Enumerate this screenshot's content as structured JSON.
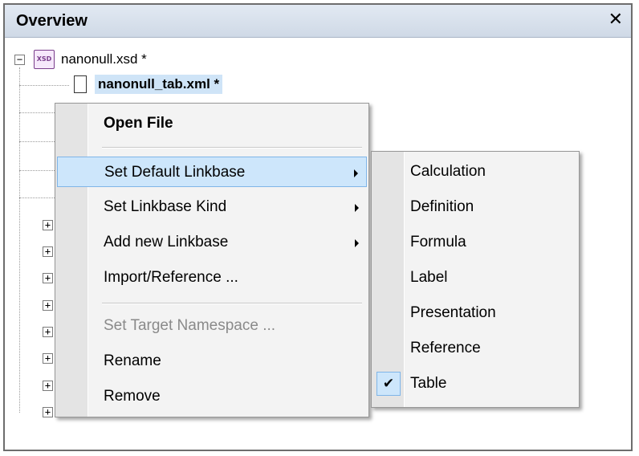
{
  "panel": {
    "title": "Overview",
    "close_glyph": "✕"
  },
  "tree": {
    "root": {
      "label": "nanonull.xsd *",
      "icon_text": "XSD",
      "icon": "xsd-file-icon",
      "expander": "−"
    },
    "selected_child": {
      "label": "nanonull_tab.xml *",
      "icon": "xml-file-icon"
    },
    "collapsed_expander": "+"
  },
  "context_menu": {
    "items": [
      {
        "label": "Open File"
      },
      {
        "label": "Set Default Linkbase"
      },
      {
        "label": "Set Linkbase Kind"
      },
      {
        "label": "Add new Linkbase"
      },
      {
        "label": "Import/Reference ..."
      },
      {
        "label": "Set Target Namespace ..."
      },
      {
        "label": "Rename"
      },
      {
        "label": "Remove"
      }
    ],
    "highlighted": "Set Default Linkbase"
  },
  "submenu": {
    "items": [
      {
        "label": "Calculation"
      },
      {
        "label": "Definition"
      },
      {
        "label": "Formula"
      },
      {
        "label": "Label"
      },
      {
        "label": "Presentation"
      },
      {
        "label": "Reference"
      },
      {
        "label": "Table"
      }
    ],
    "checked": "Table",
    "check_glyph": "✔"
  },
  "colors": {
    "highlight": "#cde6fb",
    "highlight_border": "#7fb5e8",
    "menu_bg": "#f3f3f3",
    "titlebar": "#dbe3ee"
  }
}
